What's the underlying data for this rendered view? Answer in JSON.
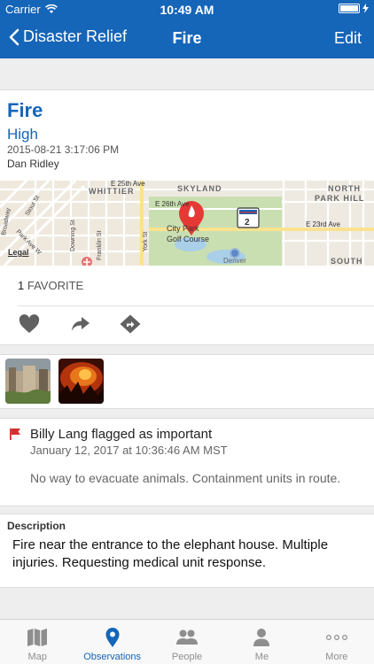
{
  "status": {
    "carrier": "Carrier",
    "time": "10:49 AM"
  },
  "nav": {
    "back_label": "Disaster Relief",
    "title": "Fire",
    "edit_label": "Edit"
  },
  "observation": {
    "title": "Fire",
    "severity": "High",
    "timestamp": "2015-08-21 3:17:06 PM",
    "user": "Dan Ridley"
  },
  "map": {
    "labels": {
      "whittier": "WHITTIER",
      "skyland": "SKYLAND",
      "north": "NORTH",
      "park_hill": "PARK HILL",
      "south": "SOUTH",
      "e26th": "E 26th Ave",
      "e23rd": "E 23rd Ave",
      "e25th": "E 25th Ave",
      "stout": "Stout St",
      "park_ave": "Park Ave W",
      "downing": "Downing St",
      "franklin": "Franklin St",
      "york": "York St",
      "broadway": "Broadway",
      "golf1": "City Park",
      "golf2": "Golf Course",
      "denver": "Denver",
      "shield": "2",
      "legal": "Legal"
    }
  },
  "favorites": {
    "count": "1",
    "label": "FAVORITE"
  },
  "flag": {
    "text": "Billy Lang flagged as important",
    "date": "January 12, 2017 at 10:36:46 AM MST",
    "comment": "No way to evacuate animals. Containment units in route."
  },
  "description": {
    "label": "Description",
    "text": "Fire near the entrance to the elephant house.  Multiple injuries.  Requesting medical unit response."
  },
  "tabs": [
    {
      "label": "Map",
      "icon": "map-icon"
    },
    {
      "label": "Observations",
      "icon": "location-pin-icon"
    },
    {
      "label": "People",
      "icon": "people-icon"
    },
    {
      "label": "Me",
      "icon": "person-icon"
    },
    {
      "label": "More",
      "icon": "more-dots-icon"
    }
  ],
  "colors": {
    "brand": "#1565b8",
    "flag": "#d32f2f",
    "pin": "#e53935"
  }
}
